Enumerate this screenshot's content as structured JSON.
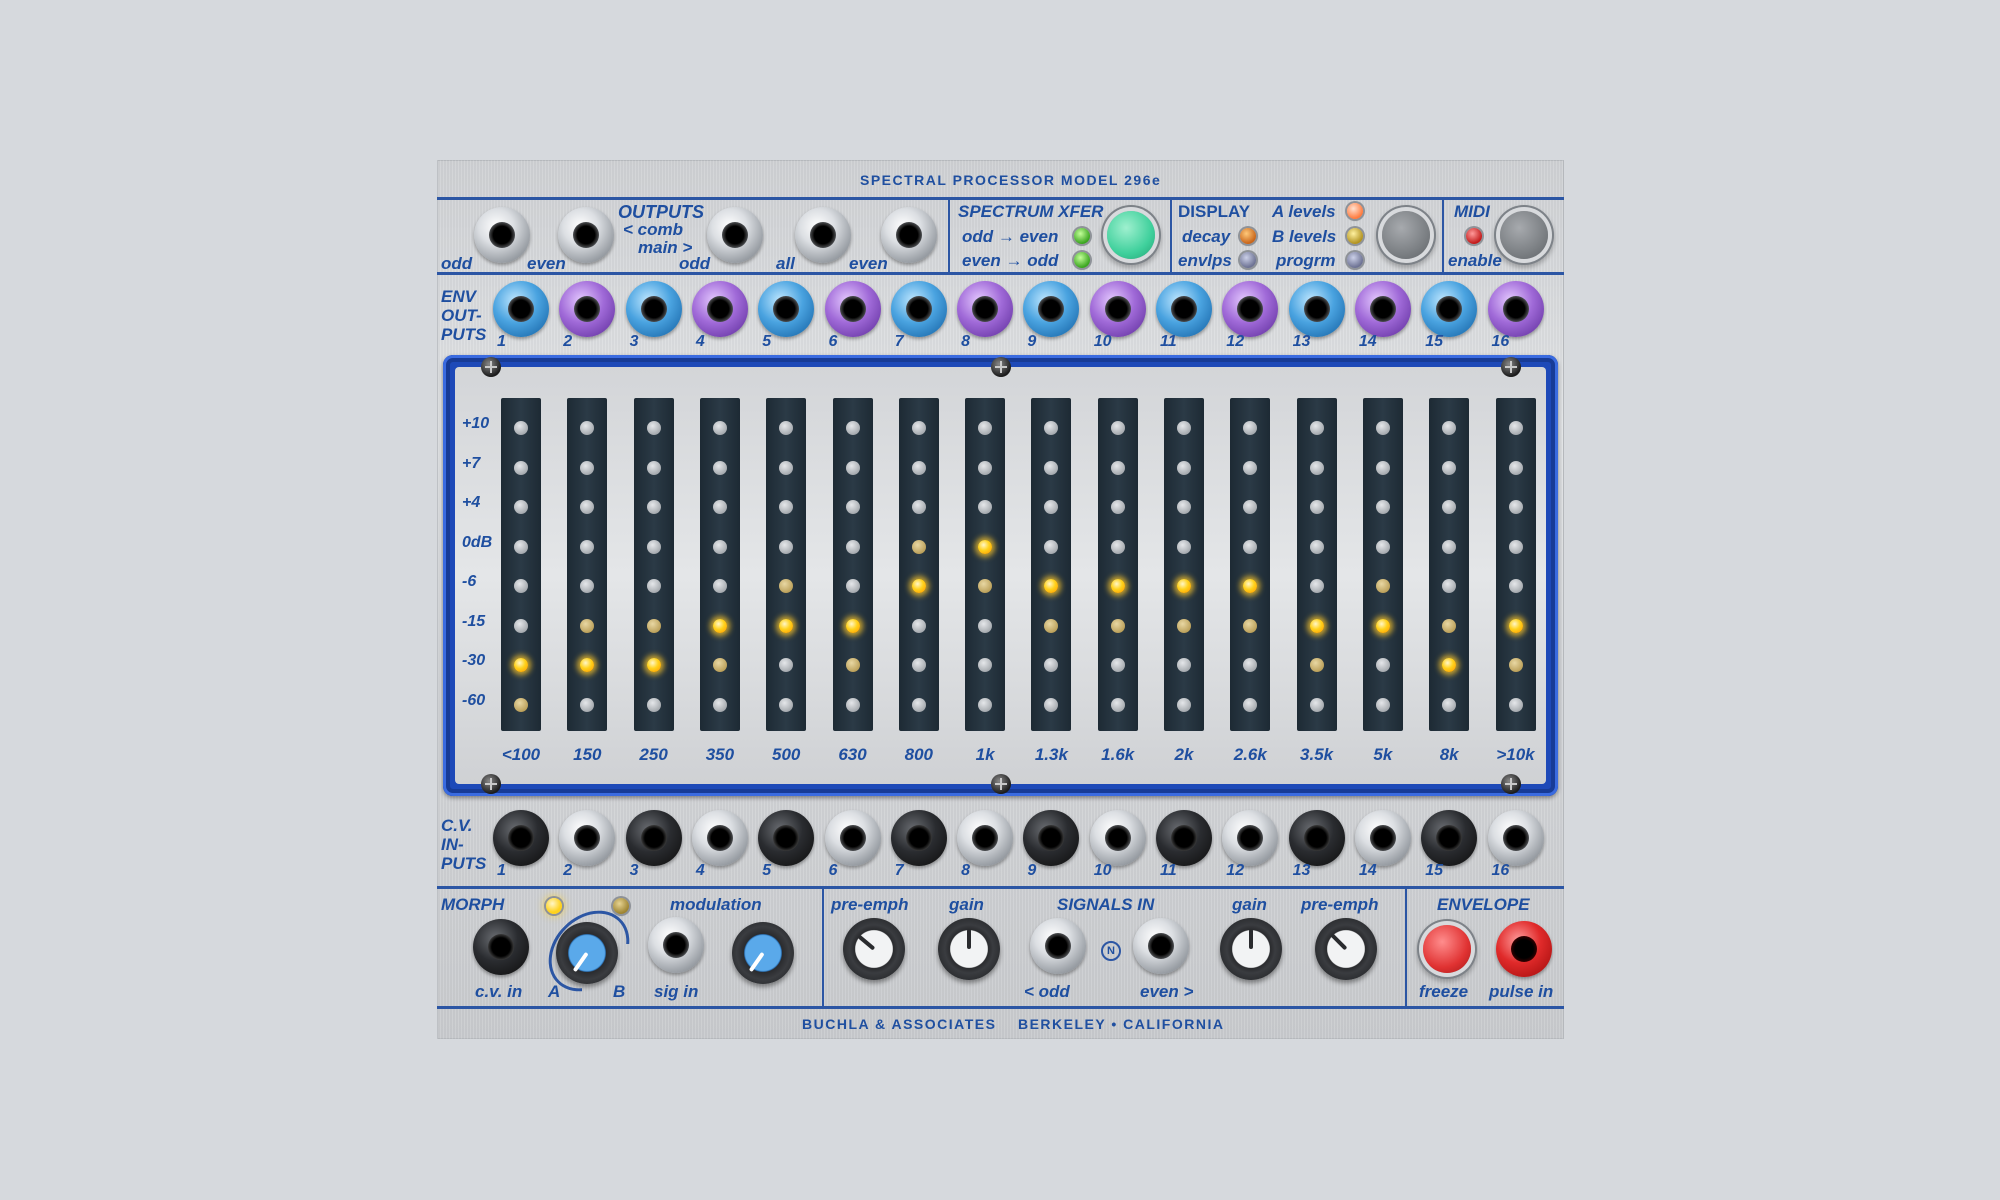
{
  "title": "SPECTRAL PROCESSOR MODEL  296e",
  "footer": "BUCHLA & ASSOCIATES    BERKELEY • CALIFORNIA",
  "outputs": {
    "heading": "OUTPUTS",
    "comb_label": "< comb",
    "main_label": "main >",
    "jack_labels": [
      "odd",
      "even",
      "odd",
      "all",
      "even"
    ]
  },
  "spectrum_xfer": {
    "heading": "SPECTRUM XFER",
    "odd_even": "odd → even",
    "even_odd": "even → odd",
    "button_color": "#3fd09c"
  },
  "display_section": {
    "heading": "DISPLAY",
    "decay": "decay",
    "envlps": "envlps",
    "a_levels": "A levels",
    "b_levels": "B levels",
    "progrm": "progrm"
  },
  "midi": {
    "heading": "MIDI",
    "enable": "enable"
  },
  "env_outputs": {
    "heading_lines": [
      "ENV",
      "OUT-",
      "PUTS"
    ],
    "numbers": [
      "1",
      "2",
      "3",
      "4",
      "5",
      "6",
      "7",
      "8",
      "9",
      "10",
      "11",
      "12",
      "13",
      "14",
      "15",
      "16"
    ]
  },
  "meter": {
    "db_labels": [
      "+10",
      "+7",
      "+4",
      "0dB",
      "-6",
      "-15",
      "-30",
      "-60"
    ],
    "bands": [
      {
        "freq": "<100",
        "lit_row": 6,
        "dim_rows": [
          7
        ]
      },
      {
        "freq": "150",
        "lit_row": 6,
        "dim_rows": [
          5
        ]
      },
      {
        "freq": "250",
        "lit_row": 6,
        "dim_rows": [
          5
        ]
      },
      {
        "freq": "350",
        "lit_row": 5,
        "dim_rows": [
          6
        ]
      },
      {
        "freq": "500",
        "lit_row": 5,
        "dim_rows": [
          4
        ]
      },
      {
        "freq": "630",
        "lit_row": 5,
        "dim_rows": [
          6
        ]
      },
      {
        "freq": "800",
        "lit_row": 4,
        "dim_rows": [
          3
        ]
      },
      {
        "freq": "1k",
        "lit_row": 3,
        "dim_rows": [
          4
        ]
      },
      {
        "freq": "1.3k",
        "lit_row": 4,
        "dim_rows": [
          5
        ]
      },
      {
        "freq": "1.6k",
        "lit_row": 4,
        "dim_rows": [
          5
        ]
      },
      {
        "freq": "2k",
        "lit_row": 4,
        "dim_rows": [
          5
        ]
      },
      {
        "freq": "2.6k",
        "lit_row": 4,
        "dim_rows": [
          5
        ]
      },
      {
        "freq": "3.5k",
        "lit_row": 5,
        "dim_rows": [
          6
        ]
      },
      {
        "freq": "5k",
        "lit_row": 5,
        "dim_rows": [
          4
        ]
      },
      {
        "freq": "8k",
        "lit_row": 6,
        "dim_rows": [
          5
        ]
      },
      {
        "freq": ">10k",
        "lit_row": 5,
        "dim_rows": [
          6
        ]
      }
    ]
  },
  "cv_inputs": {
    "heading_lines": [
      "C.V.",
      "IN-",
      "PUTS"
    ],
    "numbers": [
      "1",
      "2",
      "3",
      "4",
      "5",
      "6",
      "7",
      "8",
      "9",
      "10",
      "11",
      "12",
      "13",
      "14",
      "15",
      "16"
    ]
  },
  "morph": {
    "heading": "MORPH",
    "cv_in": "c.v. in",
    "a": "A",
    "b": "B",
    "modulation": "modulation",
    "sig_in": "sig in"
  },
  "signals_in": {
    "heading": "SIGNALS IN",
    "pre_emph": "pre-emph",
    "gain": "gain",
    "odd": "< odd",
    "even": "even >",
    "badge": "N"
  },
  "envelope": {
    "heading": "ENVELOPE",
    "freeze": "freeze",
    "pulse_in": "pulse in"
  },
  "colors": {
    "accent": "#1f4fa0",
    "led_on": "#ffd21c"
  }
}
